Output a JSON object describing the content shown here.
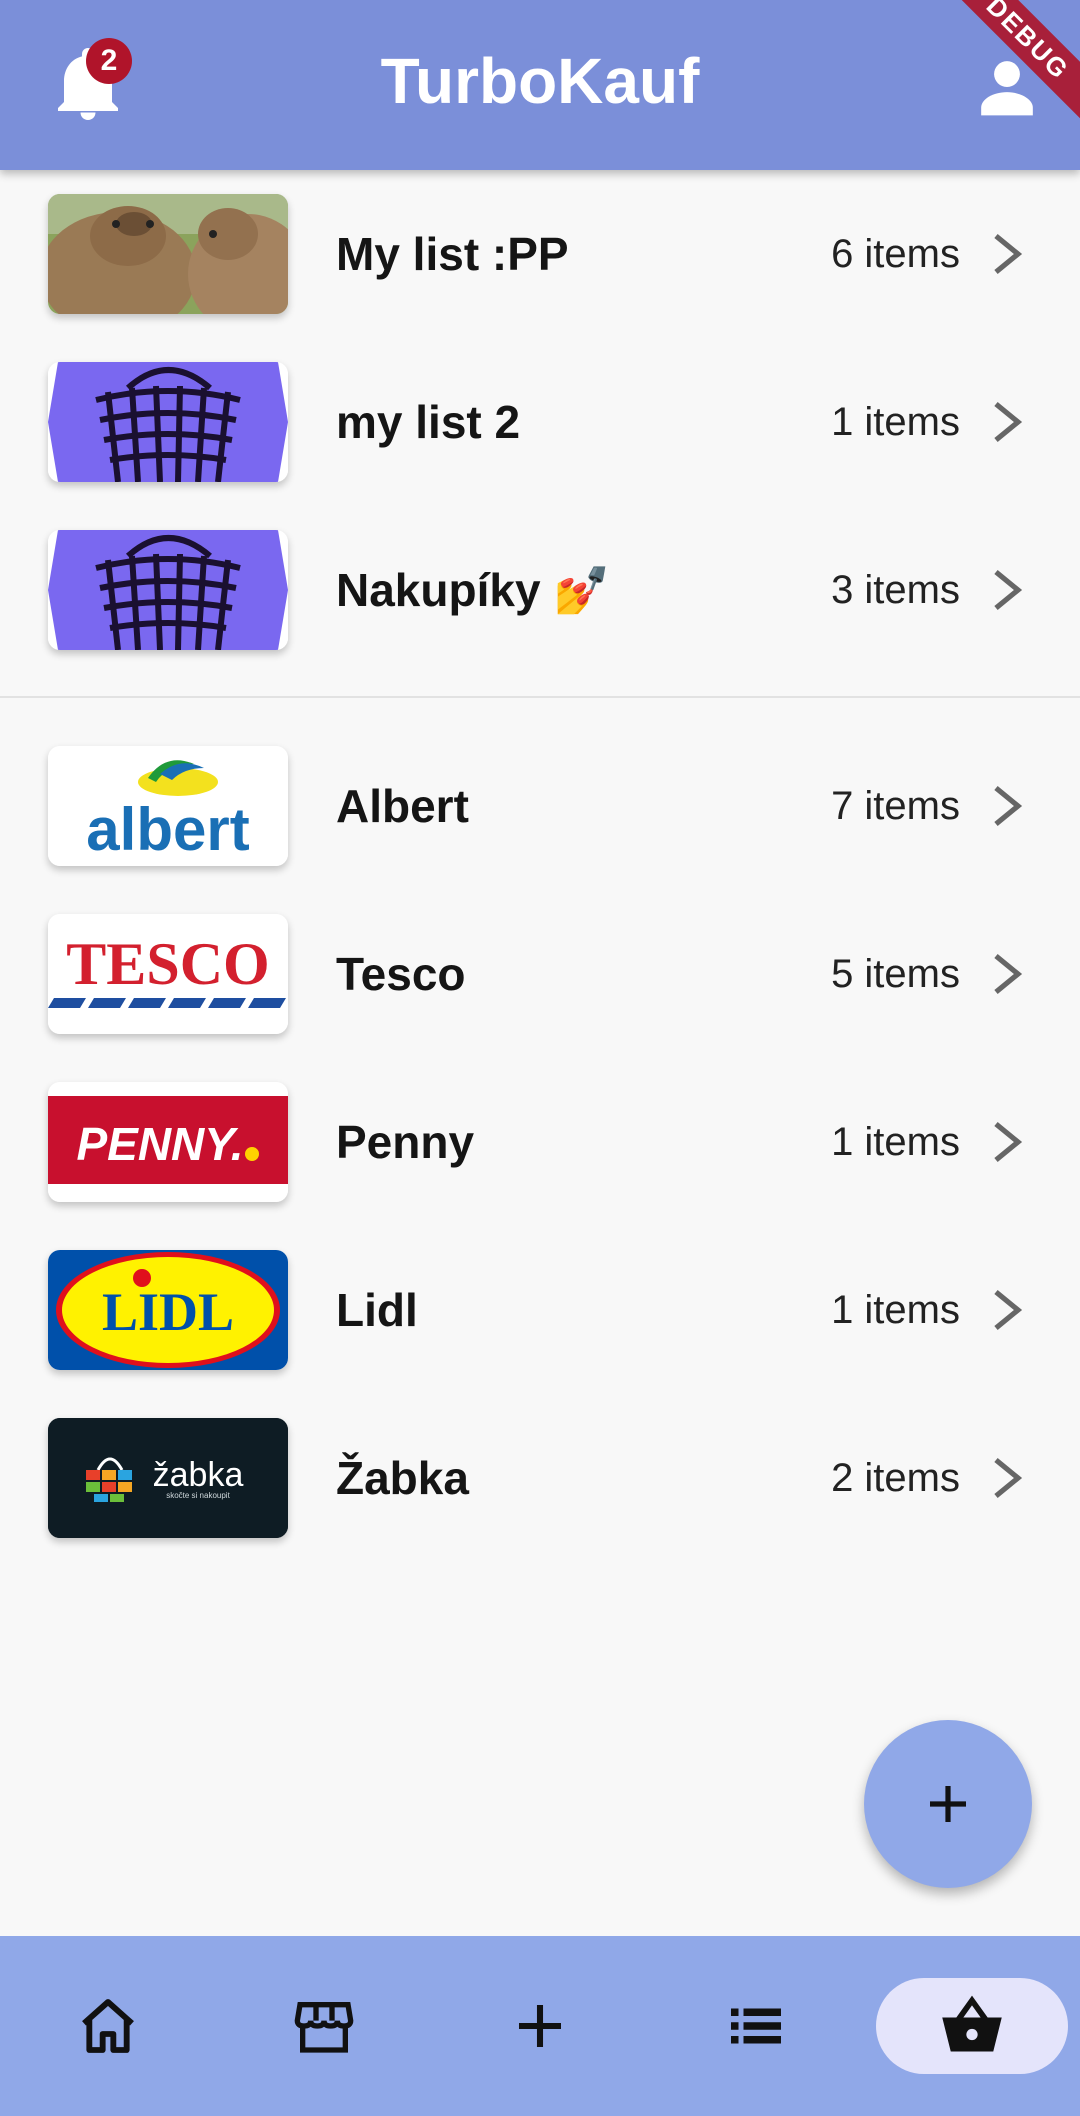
{
  "app": {
    "title": "TurboKauf",
    "notification_count": "2",
    "debug_banner": "DEBUG"
  },
  "lists": [
    {
      "name": "My list :PP",
      "count": "6 items",
      "image": "capybara-photo"
    },
    {
      "name": "my list 2",
      "count": "1 items",
      "image": "basket-logo"
    },
    {
      "name": "Nakupíky 💅",
      "count": "3 items",
      "image": "basket-logo"
    }
  ],
  "stores": [
    {
      "name": "Albert",
      "count": "7 items",
      "logo_text": "albert"
    },
    {
      "name": "Tesco",
      "count": "5 items",
      "logo_text": "TESCO"
    },
    {
      "name": "Penny",
      "count": "1 items",
      "logo_text": "PENNY."
    },
    {
      "name": "Lidl",
      "count": "1 items",
      "logo_text": "LIDL"
    },
    {
      "name": "Žabka",
      "count": "2 items",
      "logo_text": "žabka",
      "logo_subtext": "skočte si nakoupit"
    }
  ],
  "nav": {
    "items": [
      "home-icon",
      "store-icon",
      "add-icon",
      "list-icon",
      "basket-icon"
    ],
    "active": "basket-icon"
  },
  "colors": {
    "appbar": "#7b8fd9",
    "bottom_nav": "#90a8e8",
    "fab": "#90a8e8",
    "badge": "#b0142a",
    "active_nav_pill": "#e4e4fb"
  }
}
